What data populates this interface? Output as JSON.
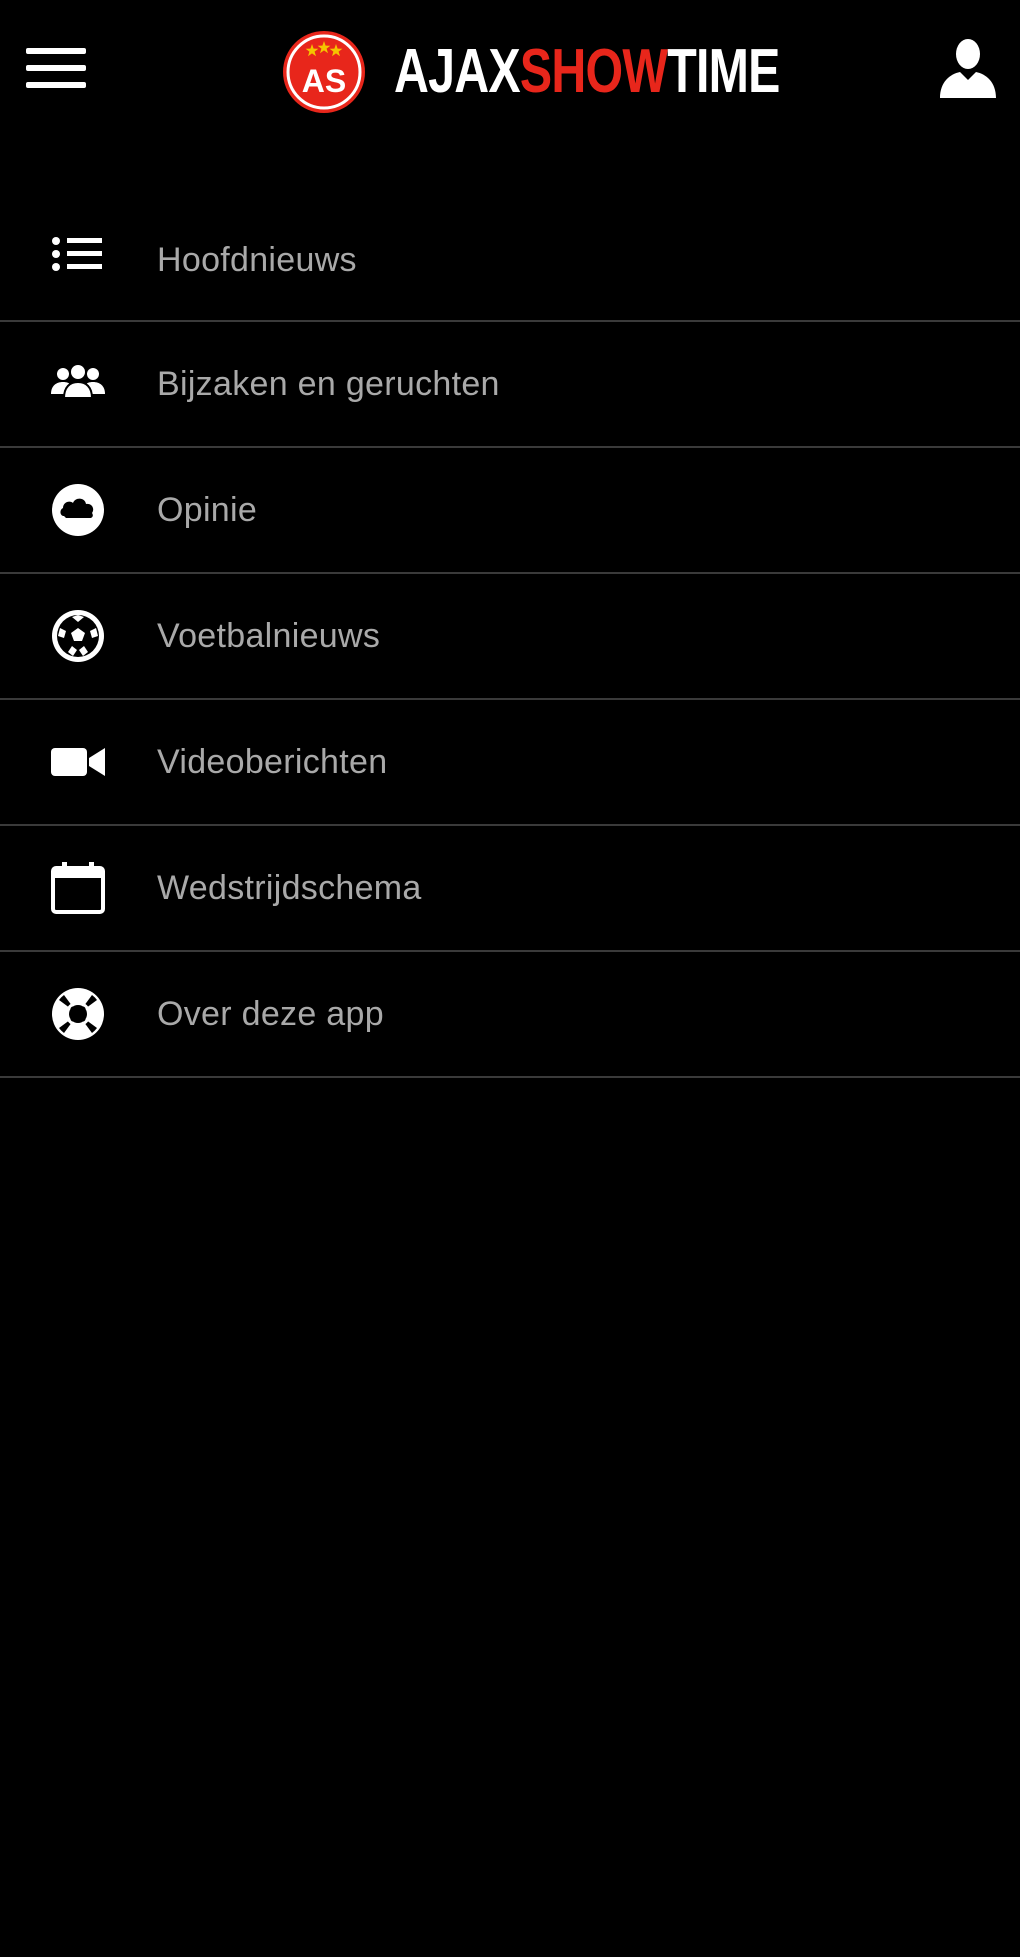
{
  "header": {
    "logo_badge_text": "AS",
    "logo_word_part1": "AJAX",
    "logo_word_part2": "SHOW",
    "logo_word_part3": "TIME",
    "menu_icon": "hamburger-icon",
    "user_icon": "user-icon"
  },
  "colors": {
    "background": "#000000",
    "brand_red": "#e8261b",
    "menu_text": "#a9a9a9",
    "divider": "#3a3a3a",
    "icon": "#ffffff"
  },
  "menu": {
    "items": [
      {
        "label": "Hoofdnieuws",
        "icon": "list-icon"
      },
      {
        "label": "Bijzaken en geruchten",
        "icon": "users-icon"
      },
      {
        "label": "Opinie",
        "icon": "cloud-icon"
      },
      {
        "label": "Voetbalnieuws",
        "icon": "soccer-ball-icon"
      },
      {
        "label": "Videoberichten",
        "icon": "video-camera-icon"
      },
      {
        "label": "Wedstrijdschema",
        "icon": "calendar-icon"
      },
      {
        "label": "Over deze app",
        "icon": "lifebuoy-icon"
      }
    ]
  }
}
